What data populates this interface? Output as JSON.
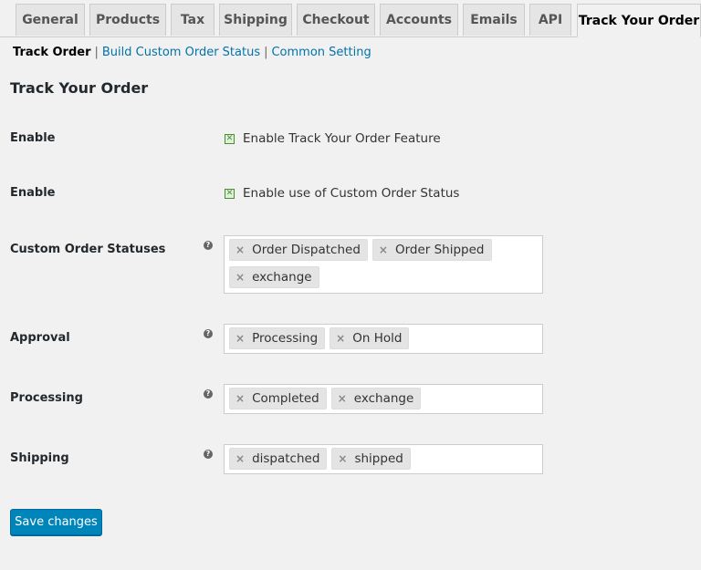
{
  "tabs": [
    {
      "label": "General"
    },
    {
      "label": "Products"
    },
    {
      "label": "Tax"
    },
    {
      "label": "Shipping"
    },
    {
      "label": "Checkout"
    },
    {
      "label": "Accounts"
    },
    {
      "label": "Emails"
    },
    {
      "label": "API"
    },
    {
      "label": "Track Your Order"
    }
  ],
  "subnav": {
    "current": "Track Order",
    "links": [
      "Build Custom Order Status",
      "Common Setting"
    ],
    "separator": "|"
  },
  "section_title": "Track Your Order",
  "settings": {
    "enable_feature": {
      "label": "Enable",
      "checkbox_text": "Enable Track Your Order Feature",
      "checked": true
    },
    "enable_custom_status": {
      "label": "Enable",
      "checkbox_text": "Enable use of Custom Order Status",
      "checked": true
    },
    "custom_order_statuses": {
      "label": "Custom Order Statuses",
      "values": [
        "Order Dispatched",
        "Order Shipped",
        "exchange"
      ]
    },
    "approval": {
      "label": "Approval",
      "values": [
        "Processing",
        "On Hold"
      ]
    },
    "processing": {
      "label": "Processing",
      "values": [
        "Completed",
        "exchange"
      ]
    },
    "shipping": {
      "label": "Shipping",
      "values": [
        "dispatched",
        "shipped"
      ]
    }
  },
  "help_glyph": "?",
  "chip_remove_glyph": "×",
  "save_button_label": "Save changes",
  "colors": {
    "accent": "#0085ba",
    "link": "#0073aa",
    "check": "#4b8c35"
  }
}
